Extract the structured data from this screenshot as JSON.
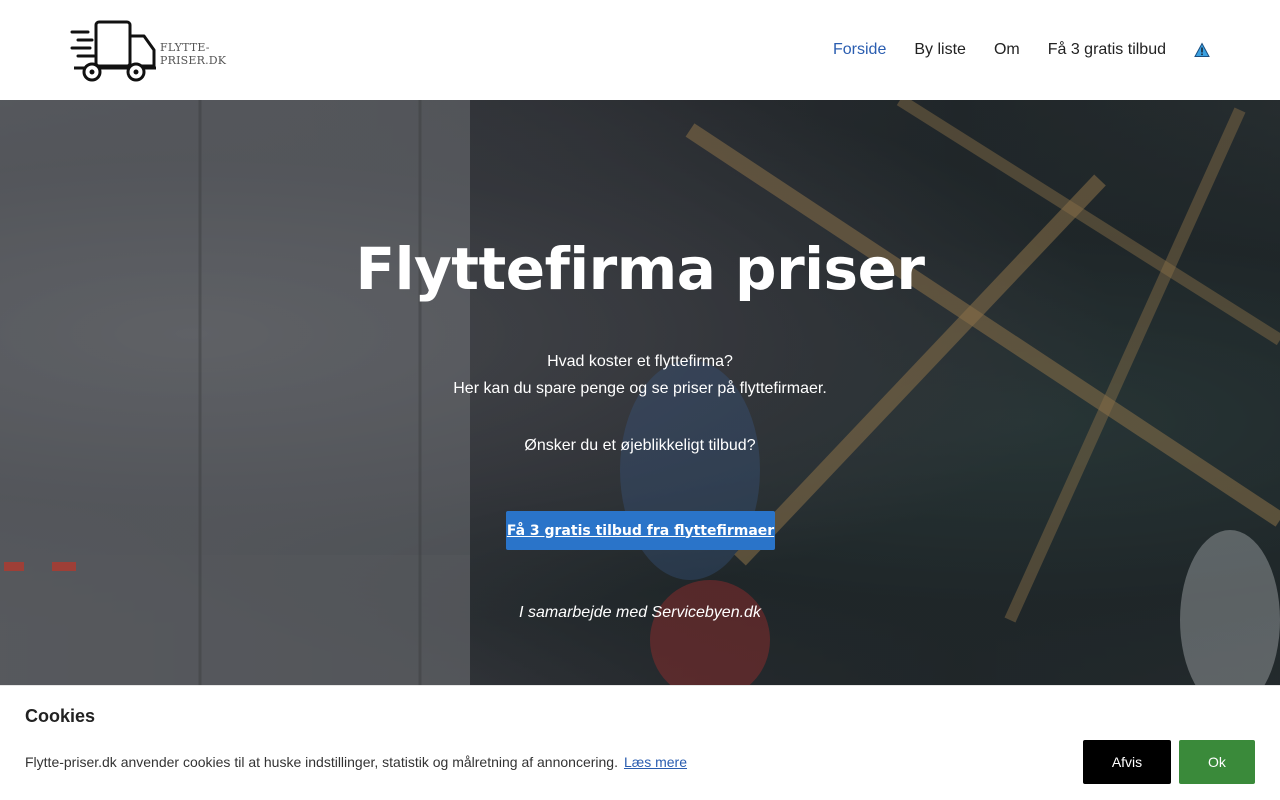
{
  "header": {
    "logo_text": "FLYTTE-PRISER.DK",
    "logo_icon": "moving-truck-icon",
    "nav": [
      {
        "label": "Forside",
        "active": true
      },
      {
        "label": "By liste",
        "active": false
      },
      {
        "label": "Om",
        "active": false
      },
      {
        "label": "Få 3 gratis tilbud",
        "active": false
      }
    ],
    "warning_icon": "warning-triangle-icon"
  },
  "hero": {
    "title": "Flyttefirma priser",
    "line1": "Hvad koster et flyttefirma?",
    "line2": "Her kan du spare penge og se priser på flyttefirmaer.",
    "line3": "Ønsker du et øjeblikkeligt tilbud?",
    "cta_label": "Få 3 gratis tilbud fra flyttefirmaer",
    "partner_text": "I samarbejde med Servicebyen.dk"
  },
  "cookie": {
    "title": "Cookies",
    "text": "Flytte-priser.dk anvender cookies til at huske indstillinger, statistik og målretning af annoncering.",
    "link_label": "Læs mere",
    "decline_label": "Afvis",
    "ok_label": "Ok"
  },
  "colors": {
    "accent": "#2a74c9",
    "nav_active": "#2a5db0",
    "ok_button": "#3a8a3a",
    "decline_button": "#000000"
  }
}
